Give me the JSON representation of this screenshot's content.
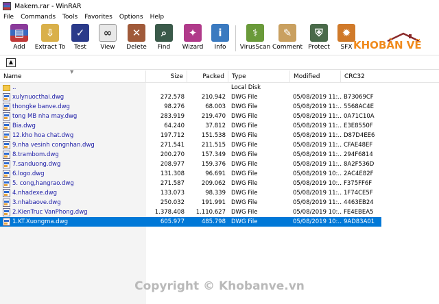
{
  "window": {
    "title": "Makem.rar - WinRAR"
  },
  "menu": [
    "File",
    "Commands",
    "Tools",
    "Favorites",
    "Options",
    "Help"
  ],
  "toolbar": [
    {
      "label": "Add",
      "icon": "add-archive-icon",
      "color": "#8a3a9a"
    },
    {
      "label": "Extract To",
      "icon": "extract-folder-icon",
      "color": "#c9a03a"
    },
    {
      "label": "Test",
      "icon": "test-book-icon",
      "color": "#2a3a8a"
    },
    {
      "label": "View",
      "icon": "view-glasses-icon",
      "color": "#888888"
    },
    {
      "label": "Delete",
      "icon": "delete-box-icon",
      "color": "#a04a3a"
    },
    {
      "label": "Find",
      "icon": "find-binoculars-icon",
      "color": "#3a5a4a"
    },
    {
      "label": "Wizard",
      "icon": "wizard-wand-icon",
      "color": "#b03a8a"
    },
    {
      "label": "Info",
      "icon": "info-icon",
      "color": "#3a7ac0"
    },
    {
      "label": "VirusScan",
      "icon": "virus-scan-icon",
      "color": "#6a9a3a"
    },
    {
      "label": "Comment",
      "icon": "comment-icon",
      "color": "#c0a060"
    },
    {
      "label": "Protect",
      "icon": "protect-shield-icon",
      "color": "#4a6a4a"
    },
    {
      "label": "SFX",
      "icon": "sfx-icon",
      "color": "#d07a2a"
    }
  ],
  "brand": {
    "kho": "KHO",
    "banve": "BẢN VẼ"
  },
  "columns": {
    "name": "Name",
    "size": "Size",
    "packed": "Packed",
    "type": "Type",
    "modified": "Modified",
    "crc": "CRC32"
  },
  "rows": [
    {
      "name": "..",
      "size": "",
      "packed": "",
      "type": "Local Disk",
      "modified": "",
      "crc": "",
      "kind": "folder"
    },
    {
      "name": "xulynuocthai.dwg",
      "size": "272.578",
      "packed": "210.942",
      "type": "DWG File",
      "modified": "05/08/2019 11:...",
      "crc": "B73069CF",
      "kind": "file"
    },
    {
      "name": "thongke banve.dwg",
      "size": "98.276",
      "packed": "68.003",
      "type": "DWG File",
      "modified": "05/08/2019 11:...",
      "crc": "5568AC4E",
      "kind": "file"
    },
    {
      "name": "tong MB nha may.dwg",
      "size": "283.919",
      "packed": "219.470",
      "type": "DWG File",
      "modified": "05/08/2019 11:...",
      "crc": "0A71C10A",
      "kind": "file"
    },
    {
      "name": "Bia.dwg",
      "size": "64.240",
      "packed": "37.812",
      "type": "DWG File",
      "modified": "05/08/2019 11:...",
      "crc": "E3E8550F",
      "kind": "file"
    },
    {
      "name": "12.kho hoa chat.dwg",
      "size": "197.712",
      "packed": "151.538",
      "type": "DWG File",
      "modified": "05/08/2019 11:...",
      "crc": "D87D4EE6",
      "kind": "file"
    },
    {
      "name": "9.nha vesinh congnhan.dwg",
      "size": "271.541",
      "packed": "211.515",
      "type": "DWG File",
      "modified": "05/08/2019 11:...",
      "crc": "CFAE48EF",
      "kind": "file"
    },
    {
      "name": "8.trambom.dwg",
      "size": "200.270",
      "packed": "157.349",
      "type": "DWG File",
      "modified": "05/08/2019 11:...",
      "crc": "294F6814",
      "kind": "file"
    },
    {
      "name": "7.sanduong.dwg",
      "size": "208.977",
      "packed": "159.376",
      "type": "DWG File",
      "modified": "05/08/2019 11:...",
      "crc": "8A2F536D",
      "kind": "file"
    },
    {
      "name": "6.logo.dwg",
      "size": "131.308",
      "packed": "96.691",
      "type": "DWG File",
      "modified": "05/08/2019 10:...",
      "crc": "2AC4E82F",
      "kind": "file"
    },
    {
      "name": "5. cong,hangrao.dwg",
      "size": "271.587",
      "packed": "209.062",
      "type": "DWG File",
      "modified": "05/08/2019 10:...",
      "crc": "F375FF6F",
      "kind": "file"
    },
    {
      "name": "4.nhadexe.dwg",
      "size": "133.073",
      "packed": "98.339",
      "type": "DWG File",
      "modified": "05/08/2019 11:...",
      "crc": "1F74CE5F",
      "kind": "file"
    },
    {
      "name": "3.nhabaove.dwg",
      "size": "250.032",
      "packed": "191.991",
      "type": "DWG File",
      "modified": "05/08/2019 11:...",
      "crc": "4463EB24",
      "kind": "file"
    },
    {
      "name": "2.KienTruc VanPhong.dwg",
      "size": "1.378.408",
      "packed": "1.110.627",
      "type": "DWG File",
      "modified": "05/08/2019 10:...",
      "crc": "FE4EBEA5",
      "kind": "file"
    },
    {
      "name": "1.KT.Xuongma.dwg",
      "size": "605.977",
      "packed": "485.798",
      "type": "DWG File",
      "modified": "05/08/2019 10:...",
      "crc": "9AD83A01",
      "kind": "file",
      "selected": true
    }
  ],
  "watermark": "Copyright © Khobanve.vn",
  "colors": {
    "selection": "#0078d7",
    "filename": "#1a1aa6",
    "brand": "#f08a1c"
  }
}
